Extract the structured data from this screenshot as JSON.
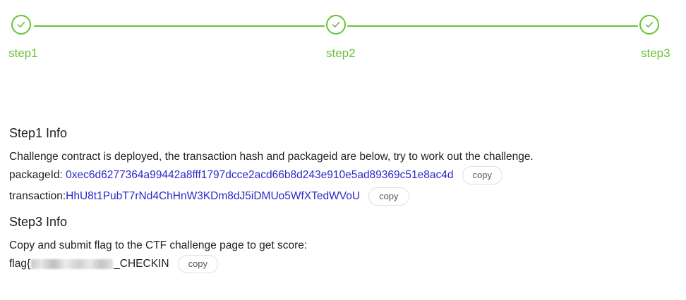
{
  "stepper": {
    "accent_color": "#67c23a",
    "steps": [
      {
        "label": "step1",
        "status": "completed",
        "icon": "check-icon"
      },
      {
        "label": "step2",
        "status": "completed",
        "icon": "check-icon"
      },
      {
        "label": "step3",
        "status": "completed",
        "icon": "check-icon"
      }
    ]
  },
  "step1_info": {
    "title": "Step1 Info",
    "description": "Challenge contract is deployed, the transaction hash and packageid are below, try to work out the challenge.",
    "package_label": "packageId:",
    "package_id": "0xec6d6277364a99442a8fff1797dcce2acd66b8d243e910e5ad89369c51e8ac4d",
    "transaction_label": "transaction:",
    "transaction": "HhU8t1PubT7rNd4ChHnW3KDm8dJ5iDMUo5WfXTedWVoU",
    "copy_label": "copy"
  },
  "step3_info": {
    "title": "Step3 Info",
    "description": "Copy and submit flag to the CTF challenge page to get score:",
    "flag_prefix": "flag{",
    "flag_suffix": "_CHECKIN",
    "copy_label": "copy"
  },
  "colors": {
    "accent": "#67c23a",
    "link": "#2c27c7"
  }
}
